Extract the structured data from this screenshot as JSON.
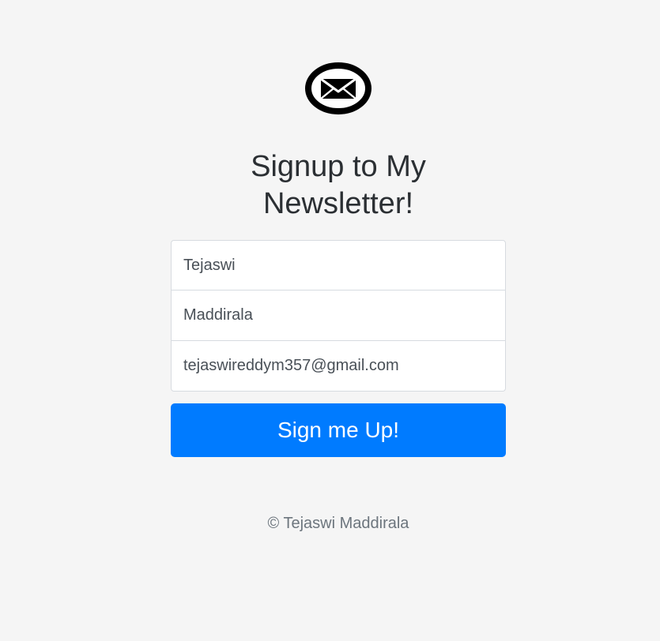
{
  "logo": {
    "icon": "envelope-icon"
  },
  "heading": {
    "line1": "Signup to My",
    "line2": "Newsletter!"
  },
  "form": {
    "first_name": {
      "value": "Tejaswi"
    },
    "last_name": {
      "value": "Maddirala"
    },
    "email": {
      "value": "tejaswireddym357@gmail.com"
    },
    "submit_label": "Sign me Up!"
  },
  "footer": {
    "copyright_text": "© Tejaswi Maddirala"
  },
  "colors": {
    "background": "#f5f5f5",
    "primary_button": "#007bff",
    "text": "#212529",
    "muted_text": "#6c757d"
  }
}
